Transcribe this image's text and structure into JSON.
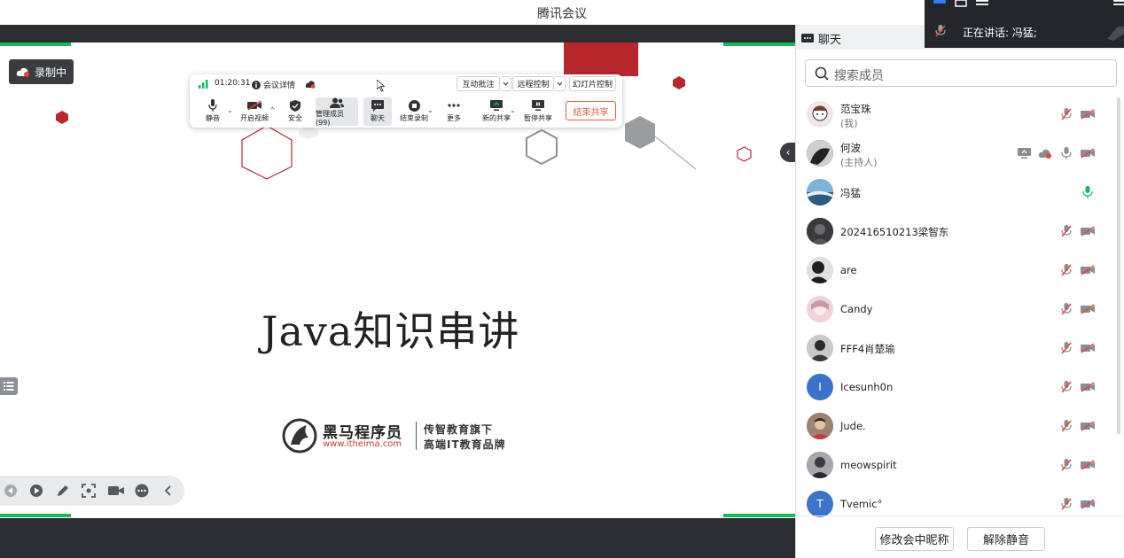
{
  "window": {
    "title": "腾讯会议"
  },
  "recording": {
    "label": "录制中"
  },
  "toolbar": {
    "time": "01:20:31",
    "details": "会议详情",
    "annotate": "互动批注",
    "remote": "远程控制",
    "slides": "幻灯片控制",
    "items": {
      "mute": "静音",
      "video": "开启视频",
      "security": "安全",
      "members": "管理成员(99)",
      "chat": "聊天",
      "endrec": "结束录制",
      "more": "更多",
      "newshare": "新的共享",
      "pause": "暂停共享"
    },
    "end_share": "结束共享"
  },
  "slide": {
    "title": "Java知识串讲",
    "logo_name": "黑马程序员",
    "logo_url": "www.itheima.com",
    "tagline1": "传智教育旗下",
    "tagline2": "高端IT教育品牌"
  },
  "panel": {
    "chat_tab": "聊天",
    "speaking": "正在讲话:  冯猛;",
    "search_placeholder": "搜索成员",
    "members": [
      {
        "name": "范宝珠",
        "role": "(我)"
      },
      {
        "name": "何波",
        "role": "(主持人)"
      },
      {
        "name": "冯猛"
      },
      {
        "name": "202416510213梁智东"
      },
      {
        "name": "are"
      },
      {
        "name": "Candy"
      },
      {
        "name": "FFF4肖楚瑜"
      },
      {
        "name": "Icesunh0n",
        "initial": "I"
      },
      {
        "name": "Jude."
      },
      {
        "name": "meowspirit"
      },
      {
        "name": "Tvemic°",
        "initial": "T"
      }
    ],
    "rename": "修改会中昵称",
    "unmute": "解除静音"
  },
  "colors": {
    "accent_green": "#18b85e",
    "danger": "#e35b3a",
    "mute_red": "#e0483e",
    "hex_red": "#b7282e"
  }
}
